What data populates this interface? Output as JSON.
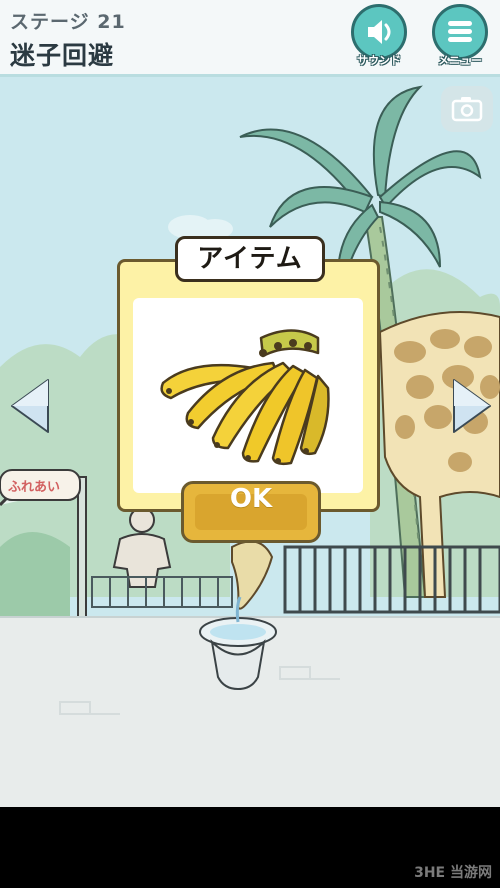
{
  "header": {
    "stage_label": "ステージ 21",
    "stage_title": "迷子回避"
  },
  "buttons": {
    "sound_label": "サウンド",
    "menu_label": "メニュー"
  },
  "scene": {
    "sign_text": "ふれあい"
  },
  "dialog": {
    "title": "アイテム",
    "item": "banana-bunch",
    "ok_label": "OK"
  },
  "watermark": "3HE 当游网",
  "colors": {
    "accent": "#5cc6c0",
    "dialog_bg": "#fdf2a6",
    "ok_button": "#e6b63c",
    "banana": "#f4d23a"
  }
}
